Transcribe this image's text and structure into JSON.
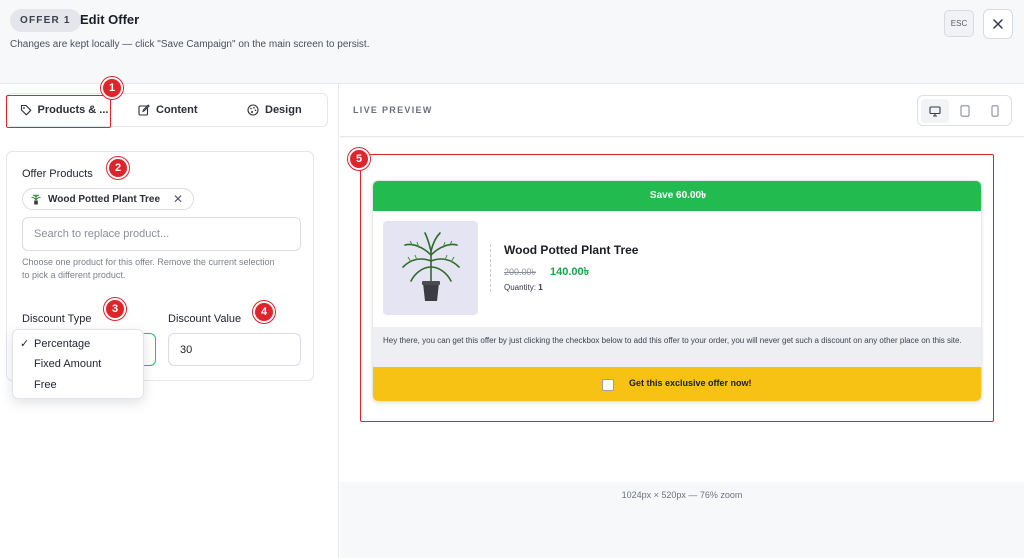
{
  "header": {
    "badge": "OFFER 1",
    "title": "Edit Offer",
    "subtitle": "Changes are kept locally — click \"Save Campaign\" on the main screen to persist.",
    "esc_label": "ESC"
  },
  "tabs": [
    {
      "label": "Products & ...",
      "icon": "tag-icon"
    },
    {
      "label": "Content",
      "icon": "edit-icon"
    },
    {
      "label": "Design",
      "icon": "palette-icon"
    }
  ],
  "markers": [
    "1",
    "2",
    "3",
    "4",
    "5"
  ],
  "form": {
    "products_label": "Offer Products",
    "selected_product": "Wood Potted Plant Tree",
    "search_placeholder": "Search to replace product...",
    "help_text": "Choose one product for this offer. Remove the current selection to pick a different product.",
    "discount_type_label": "Discount Type",
    "discount_value_label": "Discount Value",
    "discount_value": "30",
    "discount_options": [
      {
        "label": "Percentage",
        "selected": true,
        "check": "✓"
      },
      {
        "label": "Fixed Amount",
        "selected": false,
        "check": ""
      },
      {
        "label": "Free",
        "selected": false,
        "check": ""
      }
    ]
  },
  "preview": {
    "title": "LIVE PREVIEW",
    "devices": [
      "desktop-icon",
      "tablet-icon",
      "mobile-icon"
    ],
    "zoom_info": "1024px × 520px — 76% zoom",
    "offer": {
      "header_text": "Save 60.00৳",
      "product_name": "Wood Potted Plant Tree",
      "old_price": "200.00৳",
      "new_price": "140.00৳",
      "quantity_label": "Quantity:",
      "quantity_value": "1",
      "message": "Hey there, you can get this offer by just clicking the checkbox below to add this offer to your order, you will never get such a discount on any other place on this site.",
      "cta_label": "Get this exclusive offer now!"
    }
  },
  "colors": {
    "accent_green": "#22bb4f",
    "price_green": "#16a34a",
    "cta_yellow": "#f7c214",
    "highlight_red": "#e0242c"
  }
}
